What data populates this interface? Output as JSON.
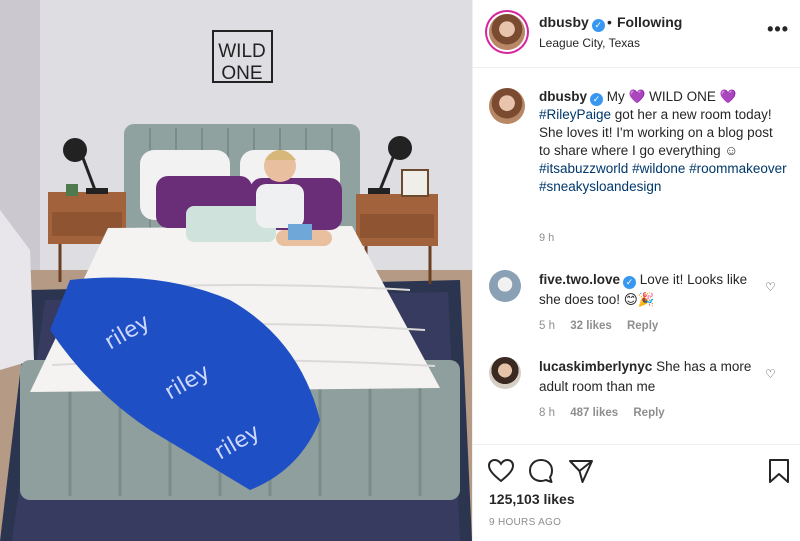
{
  "post": {
    "username": "dbusby",
    "dot": "•",
    "follow_status": "Following",
    "location": "League City, Texas",
    "more_label": "•••"
  },
  "photo": {
    "sign_line1": "WILD",
    "sign_line2": "ONE",
    "blanket_text": "riley"
  },
  "caption": {
    "username": "dbusby",
    "t1": "My",
    "t2": "WILD ONE",
    "heart": "💜",
    "hashtag1": "#RileyPaige",
    "t3": " got her a new room today! She loves it! I'm working on a blog post to share where I go everything ",
    "emoji": "☺",
    "hashtag2": "#itsabuzzworld",
    "hashtag3": "#wildone",
    "hashtag4": "#roommakeover",
    "hashtag5": "#sneakysloandesign",
    "time": "9 h"
  },
  "comments": [
    {
      "username": "five.two.love",
      "text": "Love it! Looks like she does too! 😊🎉",
      "time": "5 h",
      "likes": "32 likes",
      "reply": "Reply"
    },
    {
      "username": "lucaskimberlynyc",
      "text": "She has a more adult room than me",
      "time": "8 h",
      "likes": "487 likes",
      "reply": "Reply"
    }
  ],
  "footer": {
    "likes": "125,103 likes",
    "time": "9 HOURS AGO"
  },
  "icons": [
    "heart-icon",
    "comment-icon",
    "share-icon",
    "bookmark-icon",
    "more-icon",
    "verified-icon",
    "like-comment-icon"
  ],
  "colors": {
    "hashtag": "#00376b",
    "verified": "#3897f0",
    "meta": "#8e8e8e",
    "heart": "#8a4fd6"
  }
}
